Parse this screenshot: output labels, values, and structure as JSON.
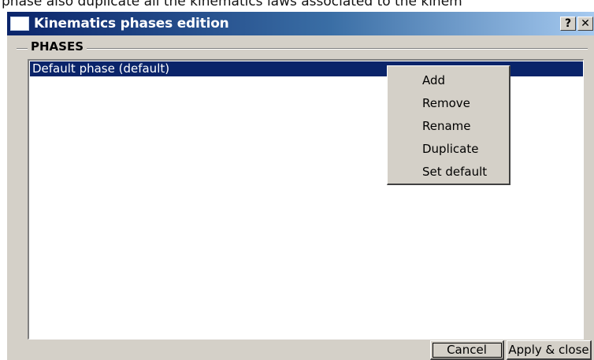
{
  "caption": "phase also duplicate all the kinematics laws associated to the kinem",
  "window": {
    "title": "Kinematics phases edition",
    "help_label": "?",
    "close_label": "✕"
  },
  "group": {
    "label": "PHASES"
  },
  "list": {
    "items": [
      {
        "label": "Default phase (default)",
        "selected": true
      }
    ]
  },
  "context_menu": {
    "items": [
      "Add",
      "Remove",
      "Rename",
      "Duplicate",
      "Set default"
    ]
  },
  "buttons": {
    "cancel": "Cancel",
    "apply": "Apply & close"
  },
  "colors": {
    "selection": "#0a246a",
    "face": "#d4d0c8"
  }
}
